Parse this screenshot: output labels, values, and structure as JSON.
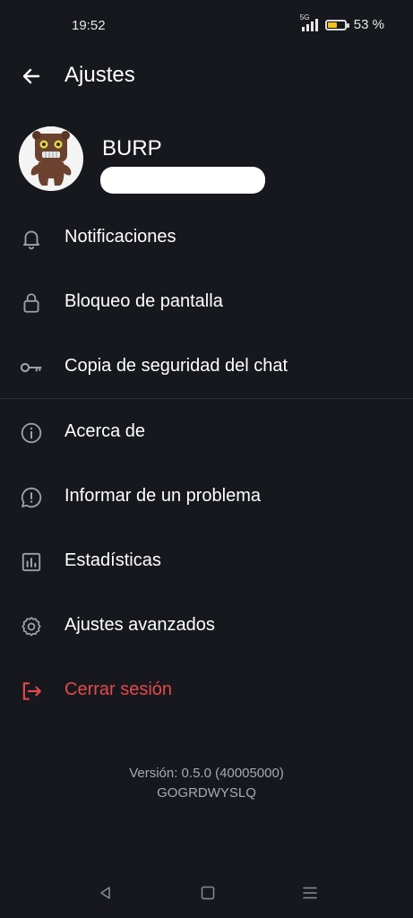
{
  "status_bar": {
    "time": "19:52",
    "network": "5G",
    "battery_percent_label": "53 %",
    "battery_level": 0.53
  },
  "header": {
    "title": "Ajustes",
    "back_icon": "arrow-left-icon"
  },
  "profile": {
    "name": "BURP",
    "avatar_icon": "bear-avatar-icon"
  },
  "menu": {
    "group1": [
      {
        "label": "Notificaciones",
        "icon": "bell-icon"
      },
      {
        "label": "Bloqueo de pantalla",
        "icon": "lock-icon"
      },
      {
        "label": "Copia de seguridad del chat",
        "icon": "key-icon"
      }
    ],
    "group2": [
      {
        "label": "Acerca de",
        "icon": "info-icon"
      },
      {
        "label": "Informar de un problema",
        "icon": "report-bubble-icon"
      },
      {
        "label": "Estadísticas",
        "icon": "chart-icon"
      },
      {
        "label": "Ajustes avanzados",
        "icon": "gear-icon"
      },
      {
        "label": "Cerrar sesión",
        "icon": "logout-icon",
        "color": "#e5484d"
      }
    ]
  },
  "version": {
    "line1": "Versión: 0.5.0 (40005000)",
    "line2": "GOGRDWYSLQ"
  },
  "colors": {
    "background": "#16181d",
    "danger": "#e5484d",
    "battery": "#f2c21b"
  }
}
